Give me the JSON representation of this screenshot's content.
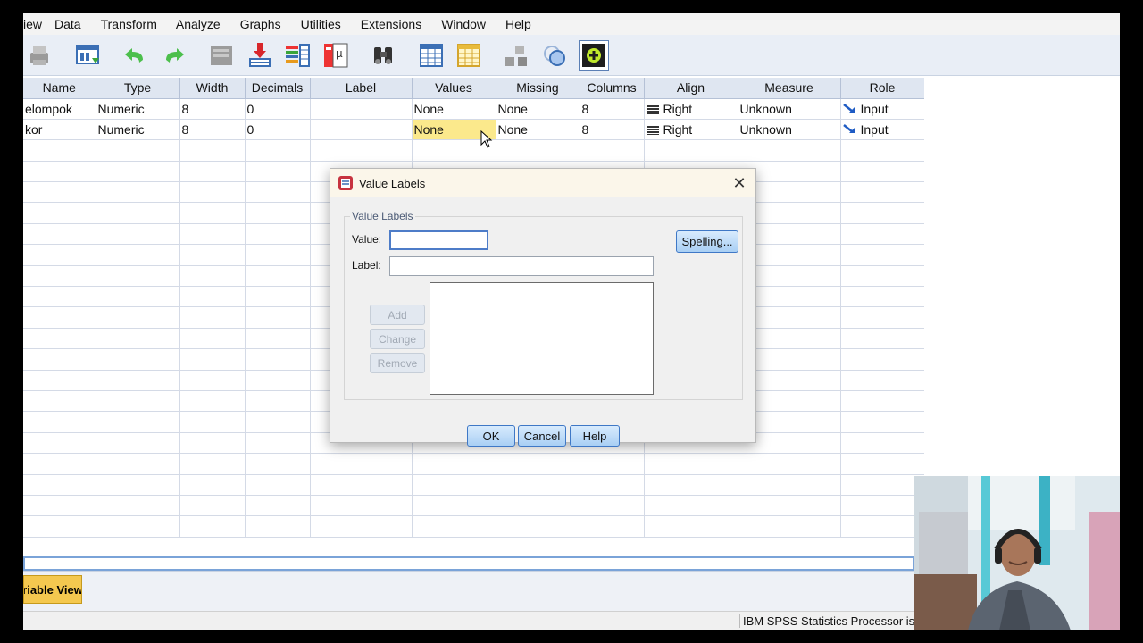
{
  "menubar": {
    "items": [
      "iew",
      "Data",
      "Transform",
      "Analyze",
      "Graphs",
      "Utilities",
      "Extensions",
      "Window",
      "Help"
    ]
  },
  "toolbar": {
    "icons": [
      "print-icon",
      "recall-dialog-icon",
      "undo-icon",
      "redo-icon",
      "goto-case-icon",
      "goto-variable-icon",
      "variables-icon",
      "value-labels-icon",
      "find-icon",
      "split-file-icon",
      "select-cases-icon",
      "weight-cases-icon",
      "use-sets-icon",
      "add-on-icon"
    ]
  },
  "grid": {
    "headers": [
      "Name",
      "Type",
      "Width",
      "Decimals",
      "Label",
      "Values",
      "Missing",
      "Columns",
      "Align",
      "Measure",
      "Role"
    ],
    "rows": [
      {
        "name": "elompok",
        "type": "Numeric",
        "width": "8",
        "decimals": "0",
        "label": "",
        "values": "None",
        "missing": "None",
        "columns": "8",
        "align": "Right",
        "measure": "Unknown",
        "role": "Input"
      },
      {
        "name": "kor",
        "type": "Numeric",
        "width": "8",
        "decimals": "0",
        "label": "",
        "values": "None",
        "missing": "None",
        "columns": "8",
        "align": "Right",
        "measure": "Unknown",
        "role": "Input"
      }
    ],
    "empty_row_count": 19
  },
  "tabs": {
    "variable_view": "riable View"
  },
  "status": {
    "processor": "IBM SPSS Statistics Processor is"
  },
  "dialog": {
    "title": "Value Labels",
    "close_glyph": "✕",
    "group_title": "Value Labels",
    "value_label": "Value:",
    "value_input": "",
    "label_label": "Label:",
    "label_input": "",
    "spelling_button": "Spelling...",
    "add_button": "Add",
    "change_button": "Change",
    "remove_button": "Remove",
    "ok_button": "OK",
    "cancel_button": "Cancel",
    "help_button": "Help"
  },
  "colors": {
    "highlight_cell": "#fbe98c",
    "header_bg": "#dfe6f1",
    "button_border": "#3f78c6",
    "tab_active": "#f4c84f"
  }
}
